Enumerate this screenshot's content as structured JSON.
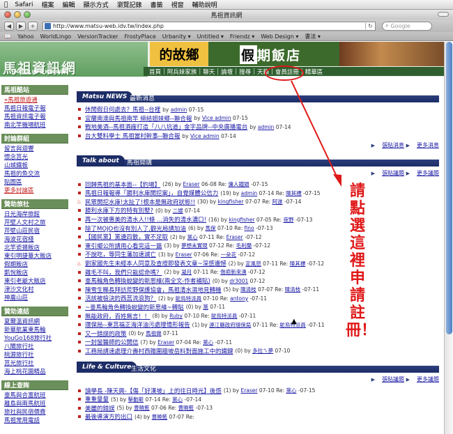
{
  "menubar": {
    "items": [
      "Safari",
      "檔案",
      "編輯",
      "顯示方式",
      "瀏覽記錄",
      "書籤",
      "視窗",
      "輔助說明"
    ]
  },
  "window": {
    "title": "馬祖資訊網"
  },
  "toolbar": {
    "back": "◀",
    "forward": "▶",
    "add": "+",
    "url": "http://www.matsu-web.idv.tw/index.php",
    "search_placeholder": "Google"
  },
  "bookmarks": [
    "Yahoo",
    "WorldLingo",
    "VersionTracker",
    "FrostyPlace",
    "Urbanity ▾",
    "Untitled ▾",
    "Friendz ▾",
    "Web Design ▾",
    "書法 ▾"
  ],
  "header": {
    "logo": "馬祖資訊網",
    "logo_sub": "MATSU INFO WEBSITE",
    "banner_left": "的故鄉",
    "banner_highlight": "假",
    "banner_right": "期飯店"
  },
  "nav": [
    "首頁",
    "阿兵妹家族",
    "聊天",
    "論壇",
    "搜尋",
    "天籟",
    "會員註冊",
    "精華區"
  ],
  "sidebar": {
    "groups": [
      {
        "title": "馬祖酷站",
        "items": [
          "»馬祖旅遊通",
          "馬祖日報電子報",
          "馬祖資訊電子報",
          "南北竿機場航班"
        ]
      },
      {
        "title": "討論群組",
        "items": [
          "留言與迴響",
          "懷念莒光",
          "山城鐵板",
          "馬祖的魚交流",
          "貼圖區",
          "更多討論區"
        ]
      },
      {
        "title": "贊助旅社",
        "items": [
          "日光海岸旅館",
          "芹壁人文村之旅",
          "芹壁山莊民宿",
          "海波花宿棧",
          "北竿瓷揚飯店",
          "東引明捷華大飯店",
          "假期飯店",
          "凱悅飯店",
          "東引老爺大飯店",
          "津沙文化村",
          "神農山莊"
        ]
      },
      {
        "title": "贊助連結",
        "items": [
          "夏爾溫資訊網",
          "新華航業東馬輪",
          "YouGo168旅行社",
          "八閩旅行社",
          "桃源旅行社",
          "莒光旅行社",
          "海上桃花園精品"
        ]
      },
      {
        "title": "線上查詢",
        "items": [
          "臺馬與合富航班",
          "離島與兩馬航班",
          "旅社與民宿價費",
          "馬祖常用電話"
        ]
      }
    ]
  },
  "sections": {
    "news": {
      "en": "Matsu NEWS",
      "zh": "最新消息",
      "actions": [
        "張貼消息",
        "更多消息"
      ],
      "items": [
        {
          "title": "休閒假日何處去？馬祖--台裡",
          "by": "by",
          "user": "admin",
          "date": "07-15",
          "hot": false
        },
        {
          "title": "宜蘭南澳與馬祖南竿 締結姐妹鄉--聯合報",
          "by": "by",
          "user": "Vice admin",
          "date": "07-15",
          "hot": false
        },
        {
          "title": "戰地美酒--馬祖酒廠打造「八八坑道」金字品牌--中央廣播電台",
          "by": "by",
          "user": "admin",
          "date": "07-14",
          "hot": false
        },
        {
          "title": "台大雙料學士 馬祖當村幹事--聯合報",
          "by": "by",
          "user": "Vice admin",
          "date": "07-14",
          "hot": false
        }
      ]
    },
    "talk": {
      "en": "Talk about",
      "zh": "馬祖開講",
      "actions": [
        "張貼議題",
        "更多議題"
      ],
      "items": [
        {
          "title": "回歸馬祖的基本面--【釣場】",
          "count": "(26)",
          "user": "Eraser",
          "date": "06-08",
          "re": "Re:",
          "ruser": "傭人鐵頭",
          "rdate": "-07-15",
          "hot": false
        },
        {
          "title": "馬祖日報報導「勝利水庫開挖案」，自覺媒體公信力",
          "count": "(19)",
          "user": "admin",
          "date": "07-14",
          "re": "Re:",
          "ruser": "陳其標",
          "rdate": "-07-15",
          "hot": false
        },
        {
          "title": "民眾開挖水庫!太扯了!根本是無政府狀態!!",
          "count": "(30)",
          "user": "kingfisher",
          "date": "07-07",
          "re": "Re:",
          "ruser": "阿遂",
          "rdate": "-07-14",
          "hot": true
        },
        {
          "title": "勝利水庫下方的特有別墅?",
          "count": "(0)",
          "user": "二嫂",
          "date": "07-14",
          "re": "",
          "ruser": "",
          "rdate": "",
          "hot": false
        },
        {
          "title": "再一次被惠美的清水人!!條 ...消失的清水濃口!",
          "count": "(16)",
          "user": "kingfisher",
          "date": "07-05",
          "re": "Re:",
          "ruser": "夜野",
          "rdate": "-07-13",
          "hot": false
        },
        {
          "title": "除了MOJO也沒有別人了,觀光局請加油",
          "count": "(6)",
          "user": "馬保",
          "date": "07-10",
          "re": "Re:",
          "ruser": "fino",
          "rdate": "-07-13",
          "hot": false
        },
        {
          "title": "【國民黨】黨邊四散，實不足取",
          "count": "(2)",
          "user": "黨心",
          "date": "07-11",
          "re": "Re:",
          "ruser": "Eraser",
          "rdate": "-07-12",
          "hot": false
        },
        {
          "title": "東引鄉公所請用心看完這一篇",
          "count": "(3)",
          "user": "夢想未實現",
          "date": "07-12",
          "re": "Re:",
          "ruser": "毛利蘭",
          "rdate": "-07-12",
          "hot": false
        },
        {
          "title": "不說吃，等同生藩加速滅亡",
          "count": "(3)",
          "user": "Eraser",
          "date": "07-06",
          "re": "Re:",
          "ruser": "一朵花",
          "rdate": "-07-12",
          "hot": false
        },
        {
          "title": "劉家國先生未經本人同意及查證即發表文章~深感遺憾",
          "count": "(2)",
          "user": "定風怒",
          "date": "07-11",
          "re": "Re:",
          "ruser": "陳其標",
          "rdate": "-07-12",
          "hot": true
        },
        {
          "title": "雞毛不叫，我們只能認命嗎？",
          "count": "(2)",
          "user": "凝月",
          "date": "07-11",
          "re": "Re:",
          "ruser": "傷疤新來湧",
          "rdate": "-07-12",
          "hot": false
        },
        {
          "title": "臺馬輪角色轉換蛻變的新思維(兩全文-作者補貼)",
          "count": "(0)",
          "user": "dr3001",
          "date": "07-12",
          "re": "",
          "ruser": "",
          "rdate": "",
          "hot": false
        },
        {
          "title": "陳雪生縣長拜訪荒野保護協會，馬祖清水濕地見轉機",
          "count": "(5)",
          "user": "陳清枝",
          "date": "07-07",
          "re": "Re:",
          "ruser": "陳清枝",
          "rdate": "-07-11",
          "hot": false
        },
        {
          "title": "活該被檢決的西莒流浪狗？",
          "count": "(2)",
          "user": "鴕鳥特派員",
          "date": "07-10",
          "re": "Re:",
          "ruser": "antony",
          "rdate": "-07-11",
          "hot": false
        },
        {
          "title": "~臺馬輪角色轉換蛻變的新思維~轉貼",
          "count": "(0)",
          "user": "黨",
          "date": "07-11",
          "re": "",
          "ruser": "",
          "rdate": "",
          "hot": false
        },
        {
          "title": "無能政府，百姓無言！！",
          "count": "(8)",
          "user": "Ruby",
          "date": "07-10",
          "re": "Re:",
          "ruser": "鴕鳥特派員",
          "rdate": "-07-11",
          "hot": false
        },
        {
          "title": "環保局--東莒福正海洋油污處理情形報告",
          "count": "(1)",
          "user": "連江縣政府環保局",
          "date": "07-11",
          "re": "Re:",
          "ruser": "鴕鳥特派員",
          "rdate": "-07-11",
          "hot": false
        },
        {
          "title": "又一錯誤的政策",
          "count": "(0)",
          "user": "馬祖做",
          "date": "07-11",
          "re": "",
          "ruser": "",
          "rdate": "",
          "hot": false
        },
        {
          "title": "一封蠻醫師的公開信",
          "count": "(7)",
          "user": "Eraser",
          "date": "07-04",
          "re": "Re:",
          "ruser": "黨心",
          "rdate": "-07-11",
          "hot": false
        },
        {
          "title": "工務局請速處理介壽村西雜圍牆坡岳料對面施工中的鐵鍵",
          "count": "(0)",
          "user": "多拉ㄟ夢",
          "date": "07-10",
          "re": "",
          "ruser": "",
          "rdate": "",
          "hot": false
        }
      ]
    },
    "life": {
      "en": "Life & Culture",
      "zh": "生活文化",
      "actions": [
        "張貼議題",
        "更多議題"
      ],
      "items": [
        {
          "title": "讀學長 -陳天興-【傷「好漢坡」上的往日時光】後感",
          "count": "(1)",
          "user": "Eraser",
          "date": "07-10",
          "re": "Re:",
          "ruser": "黨心",
          "rdate": "-07-15",
          "hot": false
        },
        {
          "title": "重重量量",
          "count": "(5)",
          "user": "擊動斯",
          "date": "07-14",
          "re": "Re:",
          "ruser": "黨心",
          "rdate": "-07-14",
          "hot": false
        },
        {
          "title": "美麗的錯誤",
          "count": "(5)",
          "user": "曹曉藍",
          "date": "07-06",
          "re": "Re:",
          "ruser": "曹曉藍",
          "rdate": "-07-13",
          "hot": false
        },
        {
          "title": "最後導演方的出口",
          "count": "(4)",
          "user": "曹曉藍",
          "date": "07-07",
          "re": "Re:",
          "ruser": "",
          "rdate": "",
          "hot": false
        }
      ]
    }
  },
  "annotation": {
    "text": "請點選這裡申請註冊！",
    "circle_target": "會員註冊"
  },
  "colors": {
    "section_bar": "#1c2c66",
    "sidebar_head": "#6b8f5a",
    "link": "#1a1aa6",
    "annotation": "#e01818"
  }
}
